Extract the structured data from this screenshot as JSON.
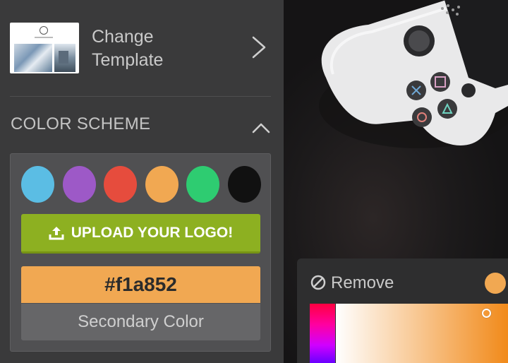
{
  "template": {
    "label": "Change\nTemplate",
    "chevron_icon": "chevron-right-icon"
  },
  "color_scheme": {
    "title": "COLOR SCHEME",
    "collapse_icon": "chevron-up-icon",
    "swatches": [
      {
        "name": "blue",
        "color": "#5bbde4"
      },
      {
        "name": "purple",
        "color": "#9d59c7"
      },
      {
        "name": "red",
        "color": "#e64c3d"
      },
      {
        "name": "orange",
        "color": "#f1a852"
      },
      {
        "name": "green",
        "color": "#2ecc71"
      },
      {
        "name": "black",
        "color": "#111111"
      }
    ],
    "upload_button": "UPLOAD YOUR LOGO!",
    "upload_icon": "upload-icon",
    "color_value": "#f1a852",
    "color_caption": "Secondary Color"
  },
  "picker": {
    "remove_label": "Remove",
    "remove_icon": "ban-icon",
    "preview_color": "#f1a852"
  },
  "colors": {
    "sidebar_bg": "#3a3a3b",
    "panel_bg": "#505052",
    "upload_green": "#8db021",
    "accent": "#f1a852"
  }
}
